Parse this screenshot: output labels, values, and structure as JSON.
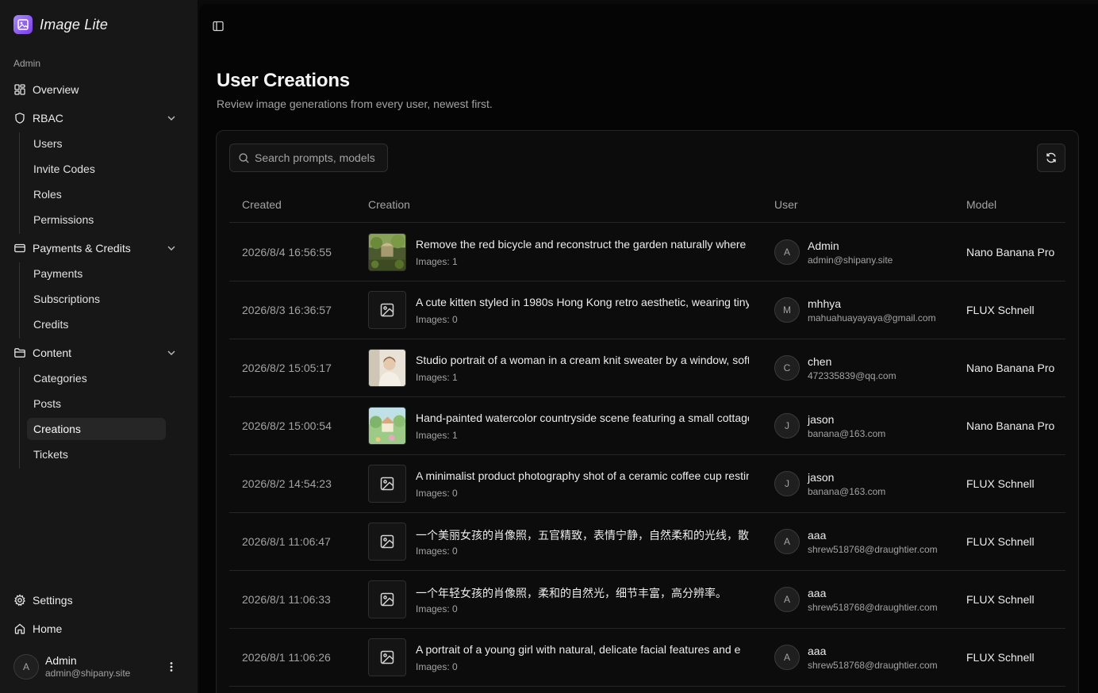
{
  "brand": {
    "name": "Image Lite"
  },
  "sidebar": {
    "group_label": "Admin",
    "items": [
      {
        "label": "Overview",
        "icon": "dashboard-icon"
      },
      {
        "label": "RBAC",
        "icon": "shield-icon",
        "children": [
          "Users",
          "Invite Codes",
          "Roles",
          "Permissions"
        ]
      },
      {
        "label": "Payments & Credits",
        "icon": "credit-card-icon",
        "children": [
          "Payments",
          "Subscriptions",
          "Credits"
        ]
      },
      {
        "label": "Content",
        "icon": "folder-icon",
        "children": [
          "Categories",
          "Posts",
          "Creations",
          "Tickets"
        ]
      }
    ],
    "active": "Creations",
    "footer_items": [
      {
        "label": "Settings",
        "icon": "gear-icon"
      },
      {
        "label": "Home",
        "icon": "home-icon"
      }
    ],
    "user": {
      "initial": "A",
      "name": "Admin",
      "email": "admin@shipany.site"
    }
  },
  "page": {
    "title": "User Creations",
    "subtitle": "Review image generations from every user, newest first."
  },
  "search": {
    "placeholder": "Search prompts, models"
  },
  "table": {
    "headers": [
      "Created",
      "Creation",
      "User",
      "Model"
    ],
    "rows": [
      {
        "created": "2026/8/4 16:56:55",
        "prompt": "Remove the red bicycle and reconstruct the garden naturally where it stood",
        "images": "Images: 1",
        "thumb": "garden",
        "user_initial": "A",
        "user_name": "Admin",
        "user_email": "admin@shipany.site",
        "model": "Nano Banana Pro"
      },
      {
        "created": "2026/8/3 16:36:57",
        "prompt": "A cute kitten styled in 1980s Hong Kong retro aesthetic, wearing tiny sunglasses",
        "images": "Images: 0",
        "thumb": "placeholder",
        "user_initial": "M",
        "user_name": "mhhya",
        "user_email": "mahuahuayayaya@gmail.com",
        "model": "FLUX Schnell"
      },
      {
        "created": "2026/8/2 15:05:17",
        "prompt": "Studio portrait of a woman in a cream knit sweater by a window, soft light",
        "images": "Images: 1",
        "thumb": "portrait",
        "user_initial": "C",
        "user_name": "chen",
        "user_email": "472335839@qq.com",
        "model": "Nano Banana Pro"
      },
      {
        "created": "2026/8/2 15:00:54",
        "prompt": "Hand-painted watercolor countryside scene featuring a small cottage",
        "images": "Images: 1",
        "thumb": "watercolor",
        "user_initial": "J",
        "user_name": "jason",
        "user_email": "banana@163.com",
        "model": "Nano Banana Pro"
      },
      {
        "created": "2026/8/2 14:54:23",
        "prompt": "A minimalist product photography shot of a ceramic coffee cup resting on",
        "images": "Images: 0",
        "thumb": "placeholder",
        "user_initial": "J",
        "user_name": "jason",
        "user_email": "banana@163.com",
        "model": "FLUX Schnell"
      },
      {
        "created": "2026/8/1 11:06:47",
        "prompt": "一个美丽女孩的肖像照，五官精致，表情宁静，自然柔和的光线，散",
        "images": "Images: 0",
        "thumb": "placeholder",
        "user_initial": "A",
        "user_name": "aaa",
        "user_email": "shrew518768@draughtier.com",
        "model": "FLUX Schnell"
      },
      {
        "created": "2026/8/1 11:06:33",
        "prompt": "一个年轻女孩的肖像照，柔和的自然光，细节丰富，高分辨率。",
        "images": "Images: 0",
        "thumb": "placeholder",
        "user_initial": "A",
        "user_name": "aaa",
        "user_email": "shrew518768@draughtier.com",
        "model": "FLUX Schnell"
      },
      {
        "created": "2026/8/1 11:06:26",
        "prompt": "A portrait of a young girl with natural, delicate facial features and e",
        "images": "Images: 0",
        "thumb": "placeholder",
        "user_initial": "A",
        "user_name": "aaa",
        "user_email": "shrew518768@draughtier.com",
        "model": "FLUX Schnell"
      }
    ]
  },
  "colors": {
    "accent": "#8b5cf6",
    "background": "#0a0a0a",
    "sidebar": "#171717"
  }
}
